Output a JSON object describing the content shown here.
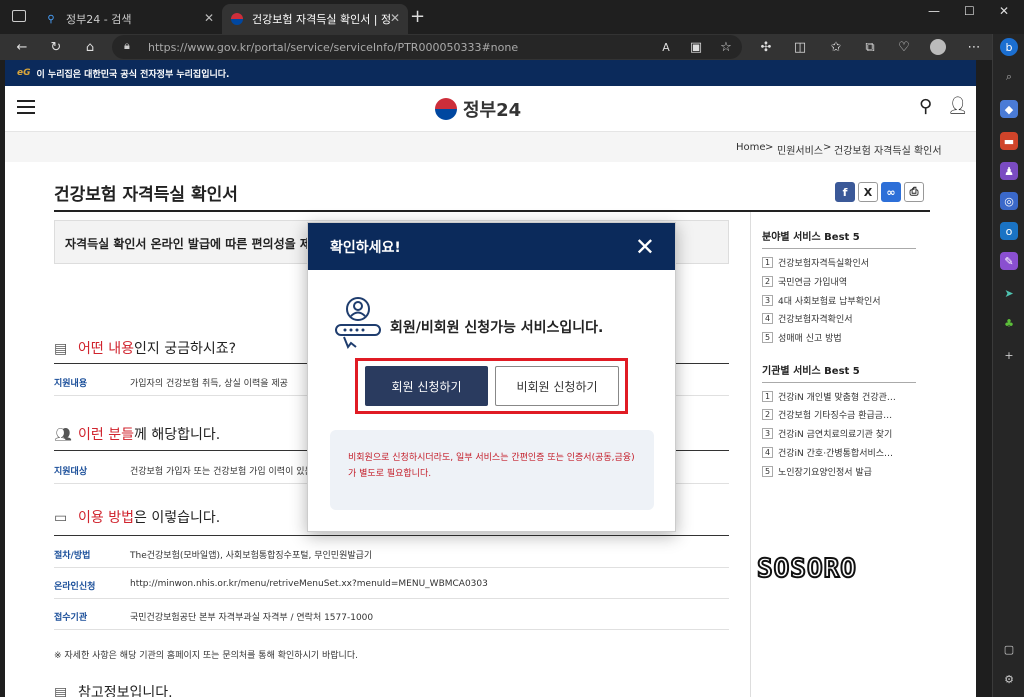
{
  "browser": {
    "tabs": [
      {
        "title": "정부24 - 검색"
      },
      {
        "title": "건강보험 자격득실 확인서 | 정부"
      }
    ],
    "url": "https://www.gov.kr/portal/service/serviceInfo/PTR000050333#none"
  },
  "govbar": {
    "text": "이 누리집은 대한민국 공식 전자정부 누리집입니다."
  },
  "site": {
    "logo_text": "정부24"
  },
  "breadcrumb": {
    "home": "Home",
    "sep": ">",
    "level1": "민원서비스",
    "level2": "건강보험 자격득실 확인서"
  },
  "page": {
    "title": "건강보험 자격득실 확인서",
    "summary": "자격득실 확인서 온라인 발급에 따른 편의성을 제공합니다.",
    "section1": {
      "hl": "어떤 내용",
      "rest": "인지 궁금하시죠?"
    },
    "row1": {
      "k": "지원내용",
      "v": "가입자의 건강보험 취득, 상실 이력을 제공"
    },
    "section2": {
      "hl": "이런 분들",
      "rest": "께 해당합니다."
    },
    "row2": {
      "k": "지원대상",
      "v": "건강보험 가입자 또는 건강보험 가입 이력이 있는"
    },
    "section3": {
      "hl": "이용 방법",
      "rest": "은 이렇습니다."
    },
    "rows3": [
      {
        "k": "절차/방법",
        "v": "The건강보험(모바일앱), 사회보험통합징수포털, 무인민원발급기"
      },
      {
        "k": "온라인신청",
        "v": "http://minwon.nhis.or.kr/menu/retriveMenuSet.xx?menuId=MENU_WBMCA0303"
      },
      {
        "k": "접수기관",
        "v": "국민건강보험공단 본부 자격부과실 자격부 / 연락처 1577-1000"
      }
    ],
    "note": "※ 자세한 사항은 해당 기관의 홈페이지 또는 문의처를 통해 확인하시기 바랍니다.",
    "section4": "참고정보입니다."
  },
  "sidebar": {
    "best1_title": "분야별 서비스 Best 5",
    "best1": [
      "건강보험자격득실확인서",
      "국민연금 가입내역",
      "4대 사회보험료 납부확인서",
      "건강보험자격확인서",
      "성매매 신고 방법"
    ],
    "best2_title": "기관별 서비스 Best 5",
    "best2": [
      "건강iN 개인별 맞춤형 건강관…",
      "건강보험 기타징수금 환급금…",
      "건강iN 금연치료의료기관 찾기",
      "건강iN 간호·간병통합서비스…",
      "노인장기요양인정서 발급"
    ]
  },
  "watermark": "SOSORO",
  "modal": {
    "title": "확인하세요!",
    "message": "회원/비회원 신청가능 서비스입니다.",
    "member_button": "회원 신청하기",
    "nonmember_button": "비회원 신청하기",
    "notice": "비회원으로 신청하시더라도, 일부 서비스는 간편인증 또는 인증서(공동,금융) 가 별도로 필요합니다."
  },
  "colors": {
    "navy": "#0b2a5b",
    "red": "#d0232d",
    "button": "#2a3b5f"
  }
}
